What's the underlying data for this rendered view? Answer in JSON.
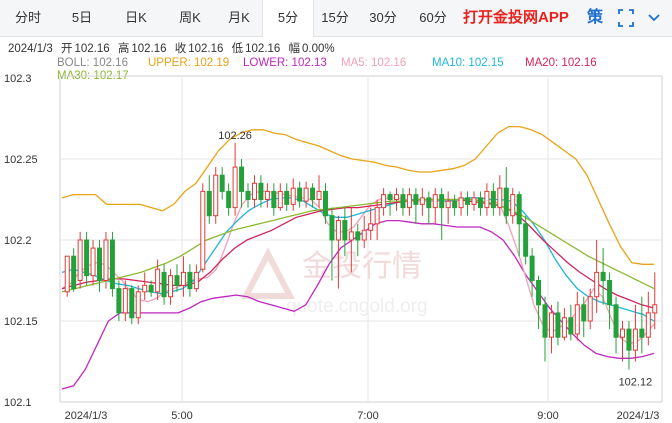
{
  "tabs": [
    "分时",
    "5日",
    "日K",
    "周K",
    "月K",
    "5分",
    "15分",
    "30分",
    "60分"
  ],
  "active_tab": "5分",
  "promo": "打开金投网APP",
  "strategy_label": "策",
  "expand_icon": "fullscreen-icon",
  "more_icon": "chevron-down-icon",
  "quote": {
    "date": "2024/1/3",
    "open_label": "开",
    "open": "102.16",
    "high_label": "高",
    "high": "102.16",
    "close_label": "收",
    "close": "102.16",
    "low_label": "低",
    "low": "102.16",
    "change_label": "幅",
    "change": "0.00%"
  },
  "indicators": [
    {
      "label": "BOLL: 102.16",
      "color": "#888888"
    },
    {
      "label": "UPPER: 102.19",
      "color": "#e8a317"
    },
    {
      "label": "LOWER: 102.13",
      "color": "#c026c0"
    },
    {
      "label": "MA5: 102.16",
      "color": "#f2a1b6"
    },
    {
      "label": "MA10: 102.15",
      "color": "#1fb6d8"
    },
    {
      "label": "MA20: 102.16",
      "color": "#d2235a"
    },
    {
      "label": "MA30: 102.17",
      "color": "#8cb830"
    }
  ],
  "watermark": {
    "name": "金投行情",
    "url": "quote.cngold.org"
  },
  "colors": {
    "up": "#e23a3a",
    "down": "#23a13a",
    "grid": "#e6e6e6"
  },
  "chart_data": {
    "type": "candlestick",
    "x_tick_labels": [
      "2024/1/3",
      "5:00",
      "7:00",
      "9:00",
      "2024/1/3"
    ],
    "y_tick_labels": [
      "102.3",
      "102.25",
      "102.2",
      "102.15",
      "102.1"
    ],
    "ylim": [
      102.1,
      102.3
    ],
    "annotations": [
      {
        "text": "102.26",
        "value": 102.26,
        "bar": 26
      },
      {
        "text": "102.12",
        "value": 102.12,
        "bar": 88
      }
    ],
    "candles": [
      [
        102.168,
        102.19,
        102.165,
        102.185
      ],
      [
        102.19,
        102.17,
        102.168,
        102.195
      ],
      [
        102.175,
        102.2,
        102.17,
        102.205
      ],
      [
        102.2,
        102.178,
        102.172,
        102.205
      ],
      [
        102.178,
        102.195,
        102.172,
        102.2
      ],
      [
        102.195,
        102.175,
        102.168,
        102.2
      ],
      [
        102.175,
        102.2,
        102.17,
        102.205
      ],
      [
        102.2,
        102.17,
        102.165,
        102.205
      ],
      [
        102.17,
        102.155,
        102.15,
        102.175
      ],
      [
        102.155,
        102.17,
        102.15,
        102.175
      ],
      [
        102.17,
        102.152,
        102.148,
        102.172
      ],
      [
        102.152,
        102.168,
        102.148,
        102.172
      ],
      [
        102.168,
        102.172,
        102.163,
        102.18
      ],
      [
        102.172,
        102.168,
        102.165,
        102.175
      ],
      [
        102.168,
        102.182,
        102.163,
        102.188
      ],
      [
        102.18,
        102.165,
        102.16,
        102.185
      ],
      [
        102.165,
        102.178,
        102.16,
        102.182
      ],
      [
        102.178,
        102.172,
        102.168,
        102.185
      ],
      [
        102.172,
        102.18,
        102.165,
        102.19
      ],
      [
        102.18,
        102.17,
        102.165,
        102.185
      ],
      [
        102.17,
        102.18,
        102.168,
        102.185
      ],
      [
        102.182,
        102.23,
        102.18,
        102.235
      ],
      [
        102.23,
        102.215,
        102.21,
        102.24
      ],
      [
        102.215,
        102.24,
        102.21,
        102.245
      ],
      [
        102.24,
        102.23,
        102.225,
        102.245
      ],
      [
        102.23,
        102.22,
        102.215,
        102.235
      ],
      [
        102.22,
        102.245,
        102.215,
        102.26
      ],
      [
        102.245,
        102.23,
        102.22,
        102.25
      ],
      [
        102.23,
        102.225,
        102.22,
        102.235
      ],
      [
        102.225,
        102.235,
        102.22,
        102.24
      ],
      [
        102.235,
        102.225,
        102.22,
        102.24
      ],
      [
        102.225,
        102.23,
        102.22,
        102.235
      ],
      [
        102.23,
        102.22,
        102.215,
        102.235
      ],
      [
        102.22,
        102.23,
        102.218,
        102.235
      ],
      [
        102.23,
        102.222,
        102.218,
        102.235
      ],
      [
        102.222,
        102.232,
        102.218,
        102.238
      ],
      [
        102.232,
        102.224,
        102.22,
        102.236
      ],
      [
        102.224,
        102.232,
        102.22,
        102.236
      ],
      [
        102.232,
        102.225,
        102.22,
        102.235
      ],
      [
        102.225,
        102.23,
        102.22,
        102.24
      ],
      [
        102.23,
        102.215,
        102.21,
        102.235
      ],
      [
        102.215,
        102.2,
        102.175,
        102.22
      ],
      [
        102.2,
        102.212,
        102.17,
        102.215
      ],
      [
        102.212,
        102.2,
        102.19,
        102.22
      ],
      [
        102.2,
        102.205,
        102.18,
        102.22
      ],
      [
        102.205,
        102.2,
        102.19,
        102.21
      ],
      [
        102.2,
        102.206,
        102.195,
        102.215
      ],
      [
        102.206,
        102.21,
        102.2,
        102.22
      ],
      [
        102.21,
        102.22,
        102.2,
        102.225
      ],
      [
        102.22,
        102.228,
        102.215,
        102.232
      ],
      [
        102.228,
        102.225,
        102.215,
        102.23
      ],
      [
        102.225,
        102.228,
        102.218,
        102.232
      ],
      [
        102.228,
        102.22,
        102.215,
        102.232
      ],
      [
        102.22,
        102.228,
        102.215,
        102.232
      ],
      [
        102.228,
        102.222,
        102.21,
        102.232
      ],
      [
        102.222,
        102.226,
        102.215,
        102.232
      ],
      [
        102.226,
        102.22,
        102.21,
        102.23
      ],
      [
        102.22,
        102.228,
        102.21,
        102.232
      ],
      [
        102.228,
        102.22,
        102.2,
        102.232
      ],
      [
        102.22,
        102.224,
        102.21,
        102.23
      ],
      [
        102.224,
        102.22,
        102.215,
        102.228
      ],
      [
        102.22,
        102.226,
        102.215,
        102.23
      ],
      [
        102.226,
        102.222,
        102.215,
        102.23
      ],
      [
        102.222,
        102.226,
        102.218,
        102.23
      ],
      [
        102.226,
        102.22,
        102.215,
        102.23
      ],
      [
        102.22,
        102.23,
        102.215,
        102.235
      ],
      [
        102.23,
        102.22,
        102.215,
        102.235
      ],
      [
        102.22,
        102.232,
        102.215,
        102.24
      ],
      [
        102.232,
        102.215,
        102.21,
        102.245
      ],
      [
        102.215,
        102.228,
        102.21,
        102.232
      ],
      [
        102.228,
        102.21,
        102.19,
        102.23
      ],
      [
        102.21,
        102.19,
        102.185,
        102.215
      ],
      [
        102.19,
        102.175,
        102.165,
        102.195
      ],
      [
        102.175,
        102.16,
        102.145,
        102.178
      ],
      [
        102.16,
        102.14,
        102.125,
        102.165
      ],
      [
        102.14,
        102.155,
        102.13,
        102.16
      ],
      [
        102.155,
        102.14,
        102.135,
        102.162
      ],
      [
        102.14,
        102.152,
        102.138,
        102.158
      ],
      [
        102.152,
        102.142,
        102.138,
        102.16
      ],
      [
        102.142,
        102.16,
        102.138,
        102.168
      ],
      [
        102.16,
        102.15,
        102.14,
        102.165
      ],
      [
        102.15,
        102.165,
        102.145,
        102.17
      ],
      [
        102.165,
        102.18,
        102.155,
        102.2
      ],
      [
        102.18,
        102.175,
        102.16,
        102.195
      ],
      [
        102.175,
        102.16,
        102.145,
        102.18
      ],
      [
        102.16,
        102.14,
        102.13,
        102.165
      ],
      [
        102.14,
        102.145,
        102.125,
        102.15
      ],
      [
        102.145,
        102.132,
        102.12,
        102.15
      ],
      [
        102.132,
        102.145,
        102.125,
        102.16
      ],
      [
        102.145,
        102.14,
        102.13,
        102.165
      ],
      [
        102.14,
        102.155,
        102.135,
        102.168
      ],
      [
        102.155,
        102.16,
        102.145,
        102.18
      ]
    ],
    "series": [
      {
        "name": "UPPER",
        "color": "#e8a317",
        "values": [
          102.226,
          102.228,
          102.228,
          102.228,
          102.222,
          102.222,
          102.222,
          102.222,
          102.22,
          102.218,
          102.222,
          102.23,
          102.235,
          102.245,
          102.255,
          102.262,
          102.266,
          102.268,
          102.268,
          102.266,
          102.265,
          102.262,
          102.26,
          102.258,
          102.255,
          102.252,
          102.25,
          102.249,
          102.248,
          102.246,
          102.245,
          102.243,
          102.242,
          102.242,
          102.243,
          102.244,
          102.246,
          102.25,
          102.258,
          102.266,
          102.27,
          102.27,
          102.268,
          102.265,
          102.26,
          102.255,
          102.25,
          102.24,
          102.225,
          102.21,
          102.196,
          102.186,
          102.185,
          102.185
        ]
      },
      {
        "name": "LOWER",
        "color": "#c026c0",
        "values": [
          102.108,
          102.11,
          102.12,
          102.135,
          102.15,
          102.155,
          102.155,
          102.155,
          102.155,
          102.155,
          102.155,
          102.158,
          102.162,
          102.164,
          102.165,
          102.166,
          102.165,
          102.162,
          102.16,
          102.158,
          102.156,
          102.16,
          102.172,
          102.185,
          102.195,
          102.2,
          102.205,
          102.21,
          102.212,
          102.212,
          102.211,
          102.21,
          102.21,
          102.209,
          102.208,
          102.208,
          102.208,
          102.205,
          102.2,
          102.19,
          102.178,
          102.168,
          102.158,
          102.15,
          102.142,
          102.135,
          102.13,
          102.128,
          102.127,
          102.127,
          102.128,
          102.13
        ]
      },
      {
        "name": "MA5",
        "color": "#f2a1b6",
        "values": [
          102.17,
          102.173,
          102.18,
          102.184,
          102.186,
          102.185,
          102.18,
          102.175,
          102.168,
          102.163,
          102.162,
          102.164,
          102.168,
          102.17,
          102.172,
          102.175,
          102.176,
          102.177,
          102.182,
          102.195,
          102.21,
          102.222,
          102.228,
          102.23,
          102.23,
          102.229,
          102.228,
          102.227,
          102.226,
          102.225,
          102.22,
          102.21,
          102.205,
          102.205,
          102.208,
          102.215,
          102.222,
          102.225,
          102.226,
          102.226,
          102.225,
          102.224,
          102.224,
          102.224,
          102.224,
          102.224,
          102.224,
          102.225,
          102.225,
          102.226,
          102.225,
          102.222,
          102.21,
          102.195,
          102.178,
          102.16,
          102.148,
          102.143,
          102.146,
          102.15,
          102.155,
          102.162,
          102.17,
          102.165,
          102.152,
          102.14,
          102.136,
          102.137,
          102.142,
          102.148
        ]
      },
      {
        "name": "MA10",
        "color": "#1fb6d8",
        "values": [
          102.18,
          102.182,
          102.18,
          102.178,
          102.175,
          102.173,
          102.172,
          102.17,
          102.168,
          102.167,
          102.168,
          102.17,
          102.175,
          102.185,
          102.195,
          102.205,
          102.212,
          102.218,
          102.222,
          102.225,
          102.226,
          102.226,
          102.224,
          102.22,
          102.216,
          102.214,
          102.214,
          102.216,
          102.218,
          102.22,
          102.222,
          102.224,
          102.225,
          102.225,
          102.225,
          102.224,
          102.225,
          102.226,
          102.226,
          102.225,
          102.225,
          102.224,
          102.218,
          102.21,
          102.2,
          102.188,
          102.178,
          102.17,
          102.165,
          102.162,
          102.16,
          102.158,
          102.156,
          102.154,
          102.15
        ]
      },
      {
        "name": "MA20",
        "color": "#d2235a",
        "values": [
          102.17,
          102.172,
          102.174,
          102.175,
          102.176,
          102.176,
          102.175,
          102.174,
          102.173,
          102.172,
          102.172,
          102.174,
          102.18,
          102.188,
          102.195,
          102.2,
          102.203,
          102.206,
          102.21,
          102.214,
          102.216,
          102.218,
          102.219,
          102.22,
          102.22,
          102.221,
          102.222,
          102.223,
          102.224,
          102.225,
          102.225,
          102.225,
          102.225,
          102.224,
          102.223,
          102.222,
          102.22,
          102.215,
          102.208,
          102.2,
          102.193,
          102.186,
          102.18,
          102.175,
          102.17,
          102.166,
          102.163,
          102.16,
          102.158
        ]
      },
      {
        "name": "MA30",
        "color": "#8cb830",
        "values": [
          102.168,
          102.17,
          102.172,
          102.174,
          102.176,
          102.178,
          102.18,
          102.183,
          102.186,
          102.19,
          102.195,
          102.2,
          102.203,
          102.206,
          102.208,
          102.21,
          102.212,
          102.214,
          102.216,
          102.218,
          102.219,
          102.22,
          102.221,
          102.222,
          102.223,
          102.224,
          102.224,
          102.225,
          102.225,
          102.225,
          102.225,
          102.225,
          102.224,
          102.222,
          102.219,
          102.215,
          102.21,
          102.205,
          102.2,
          102.195,
          102.19,
          102.186,
          102.182,
          102.178,
          102.174,
          102.17
        ]
      }
    ]
  }
}
